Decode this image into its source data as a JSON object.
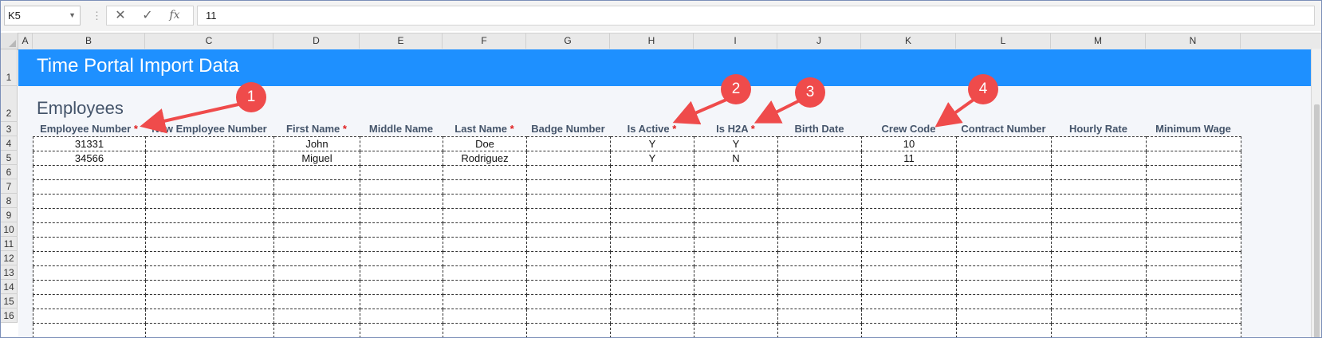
{
  "formula_bar": {
    "name_box": "K5",
    "cancel_icon": "✕",
    "enter_icon": "✓",
    "fx_label": "fx",
    "value": "11"
  },
  "columns": [
    "A",
    "B",
    "C",
    "D",
    "E",
    "F",
    "G",
    "H",
    "I",
    "J",
    "K",
    "L",
    "M",
    "N"
  ],
  "rows": [
    "1",
    "2",
    "3",
    "4",
    "5",
    "6",
    "7",
    "8",
    "9",
    "10",
    "11",
    "12",
    "13",
    "14",
    "15",
    "16"
  ],
  "sheet": {
    "banner_title": "Time Portal Import Data",
    "section_title": "Employees",
    "required_mark": "*",
    "headers": [
      {
        "label": "Employee Number",
        "required": true
      },
      {
        "label": "New Employee Number",
        "required": false
      },
      {
        "label": "First Name",
        "required": true
      },
      {
        "label": "Middle Name",
        "required": false
      },
      {
        "label": "Last Name",
        "required": true
      },
      {
        "label": "Badge Number",
        "required": false
      },
      {
        "label": "Is Active",
        "required": true
      },
      {
        "label": "Is H2A",
        "required": true
      },
      {
        "label": "Birth Date",
        "required": false
      },
      {
        "label": "Crew Code",
        "required": false
      },
      {
        "label": "Contract Number",
        "required": false
      },
      {
        "label": "Hourly Rate",
        "required": false
      },
      {
        "label": "Minimum Wage",
        "required": false
      }
    ],
    "data_rows": [
      [
        "31331",
        "",
        "John",
        "",
        "Doe",
        "",
        "Y",
        "Y",
        "",
        "10",
        "",
        "",
        ""
      ],
      [
        "34566",
        "",
        "Miguel",
        "",
        "Rodriguez",
        "",
        "Y",
        "N",
        "",
        "11",
        "",
        "",
        ""
      ]
    ],
    "empty_row_count": 12
  },
  "callouts": [
    "1",
    "2",
    "3",
    "4"
  ],
  "colors": {
    "banner": "#1e90ff",
    "header_text": "#44546a",
    "required": "#e02020",
    "callout": "#ef4b4b"
  }
}
